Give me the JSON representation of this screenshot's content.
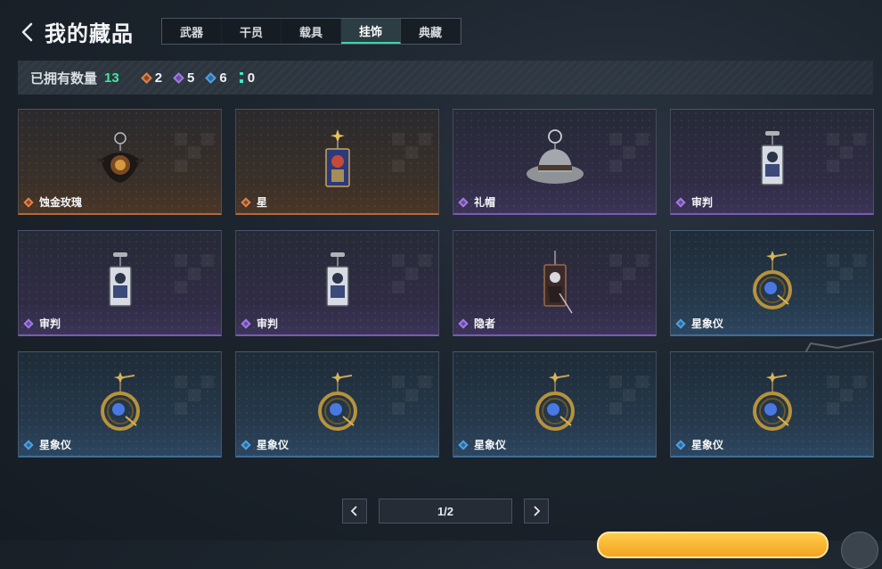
{
  "header": {
    "title": "我的藏品",
    "tabs": [
      {
        "label": "武器",
        "active": false
      },
      {
        "label": "干员",
        "active": false
      },
      {
        "label": "载具",
        "active": false
      },
      {
        "label": "挂饰",
        "active": true
      },
      {
        "label": "典藏",
        "active": false
      }
    ]
  },
  "stats": {
    "owned_label": "已拥有数量",
    "owned_count": "13",
    "counts": [
      {
        "rarity": "orange",
        "value": "2"
      },
      {
        "rarity": "purple",
        "value": "5"
      },
      {
        "rarity": "blue",
        "value": "6"
      },
      {
        "rarity": "teal",
        "value": "0"
      }
    ]
  },
  "items": [
    {
      "name": "蚀金玫瑰",
      "rarity": "orange",
      "icon": "rose-charm-icon"
    },
    {
      "name": "星",
      "rarity": "orange",
      "icon": "star-card-charm-icon"
    },
    {
      "name": "礼帽",
      "rarity": "purple",
      "icon": "fedora-hat-charm-icon"
    },
    {
      "name": "审判",
      "rarity": "purple",
      "icon": "judgement-card-charm-icon"
    },
    {
      "name": "审判",
      "rarity": "purple",
      "icon": "judgement-card-charm-icon"
    },
    {
      "name": "审判",
      "rarity": "purple",
      "icon": "judgement-card-charm-icon"
    },
    {
      "name": "隐者",
      "rarity": "purple",
      "icon": "hermit-card-charm-icon"
    },
    {
      "name": "星象仪",
      "rarity": "blue",
      "icon": "astrolabe-charm-icon"
    },
    {
      "name": "星象仪",
      "rarity": "blue",
      "icon": "astrolabe-charm-icon"
    },
    {
      "name": "星象仪",
      "rarity": "blue",
      "icon": "astrolabe-charm-icon"
    },
    {
      "name": "星象仪",
      "rarity": "blue",
      "icon": "astrolabe-charm-icon"
    },
    {
      "name": "星象仪",
      "rarity": "blue",
      "icon": "astrolabe-charm-icon"
    }
  ],
  "pagination": {
    "text": "1/2"
  },
  "colors": {
    "accent": "#3ee9a0",
    "orange": "#e0824a",
    "purple": "#a07be0",
    "blue": "#4fa0e0"
  }
}
